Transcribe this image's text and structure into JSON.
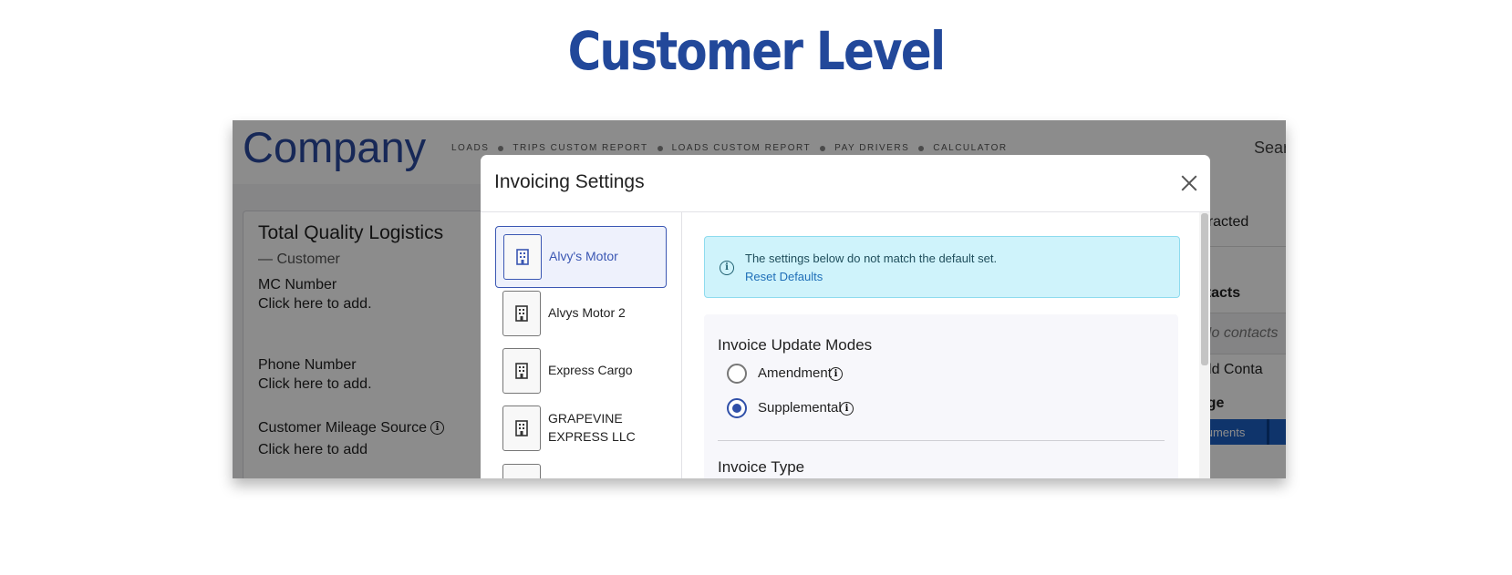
{
  "page": {
    "title": "Customer Level"
  },
  "app": {
    "logo": "Company",
    "nav": [
      "LOADS",
      "TRIPS CUSTOM REPORT",
      "LOADS CUSTOM REPORT",
      "PAY DRIVERS",
      "CALCULATOR"
    ],
    "search_text": "Sear"
  },
  "customer": {
    "name": "Total Quality Logistics",
    "role": "— Customer",
    "fields": [
      {
        "label": "MC Number",
        "value": "Click here to add."
      },
      {
        "label": "Phone Number",
        "value": "Click here to add."
      },
      {
        "label": "Customer Mileage Source",
        "value": "Click here to add"
      }
    ]
  },
  "right_panel": {
    "contracted": "Contracted",
    "contacts_heading": "ntacts",
    "no_contacts": "No contacts",
    "add_contact": "Add Conta",
    "manage": "nage",
    "documents_tab": "ocuments"
  },
  "modal": {
    "title": "Invoicing Settings",
    "companies": [
      {
        "name": "Alvy's Motor",
        "selected": true
      },
      {
        "name": "Alvys Motor 2",
        "selected": false
      },
      {
        "name": "Express Cargo",
        "selected": false
      },
      {
        "name": "GRAPEVINE EXPRESS LLC",
        "selected": false
      }
    ],
    "alert": {
      "text": "The settings below do not match the default set.",
      "link": "Reset Defaults"
    },
    "update_modes": {
      "heading": "Invoice Update Modes",
      "options": [
        {
          "label": "Amendment",
          "checked": false
        },
        {
          "label": "Supplemental",
          "checked": true
        }
      ]
    },
    "invoice_type_heading": "Invoice Type"
  },
  "colors": {
    "title_blue": "#22489a",
    "accent": "#2f4fa8",
    "alert_bg": "#cff3fb",
    "documents_tab": "#1d5fc4"
  }
}
